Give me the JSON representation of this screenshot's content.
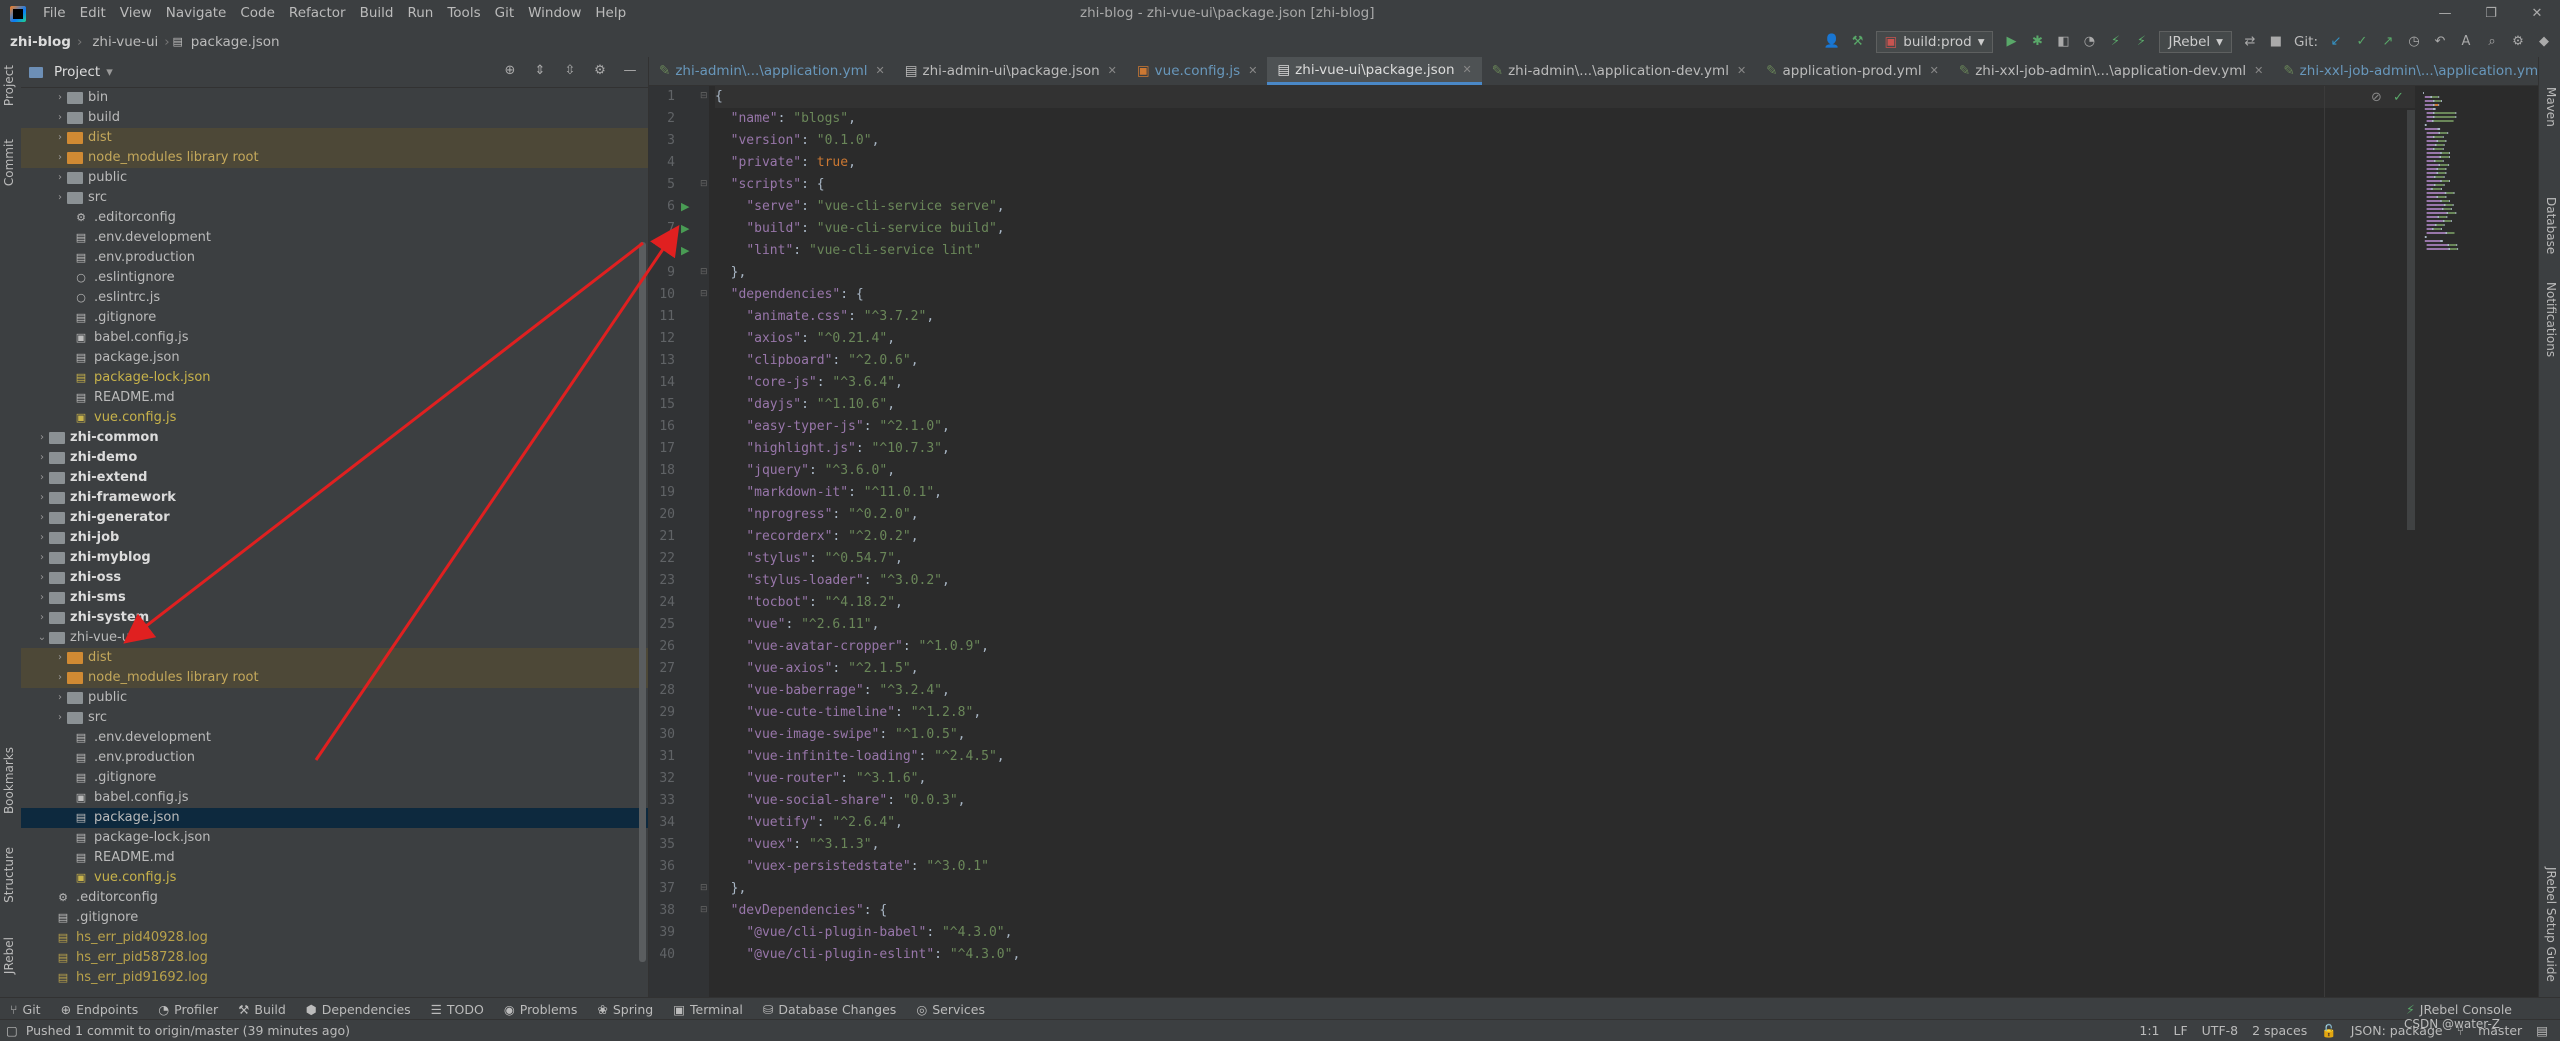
{
  "menubar": {
    "items": [
      "File",
      "Edit",
      "View",
      "Navigate",
      "Code",
      "Refactor",
      "Build",
      "Run",
      "Tools",
      "Git",
      "Window",
      "Help"
    ],
    "window_title": "zhi-blog - zhi-vue-ui\\package.json [zhi-blog]"
  },
  "navbar": {
    "breadcrumb": [
      "zhi-blog",
      "zhi-vue-ui",
      "package.json"
    ],
    "run_config": "build:prod",
    "jrebel": "JRebel",
    "git_label": "Git:"
  },
  "project_panel": {
    "title": "Project",
    "tree": [
      {
        "label": "bin",
        "type": "folder",
        "depth": 2,
        "arrow": "›",
        "style": "f-txt",
        "color": "grey"
      },
      {
        "label": "build",
        "type": "folder",
        "depth": 2,
        "arrow": "›",
        "style": "f-txt",
        "color": "grey"
      },
      {
        "label": "dist",
        "type": "folder",
        "depth": 2,
        "arrow": "›",
        "style": "f-excl",
        "color": "orange",
        "excluded": true
      },
      {
        "label": "node_modules  library root",
        "type": "folder",
        "depth": 2,
        "arrow": "›",
        "style": "f-excl",
        "color": "orange",
        "excluded": true
      },
      {
        "label": "public",
        "type": "folder",
        "depth": 2,
        "arrow": "›",
        "style": "f-txt",
        "color": "grey"
      },
      {
        "label": "src",
        "type": "folder",
        "depth": 2,
        "arrow": "›",
        "style": "f-txt",
        "color": "grey"
      },
      {
        "label": ".editorconfig",
        "type": "file",
        "depth": 2,
        "icon": "⚙",
        "style": "f-txt"
      },
      {
        "label": ".env.development",
        "type": "file",
        "depth": 2,
        "icon": "▤",
        "style": "f-txt"
      },
      {
        "label": ".env.production",
        "type": "file",
        "depth": 2,
        "icon": "▤",
        "style": "f-txt"
      },
      {
        "label": ".eslintignore",
        "type": "file",
        "depth": 2,
        "icon": "○",
        "style": "f-txt"
      },
      {
        "label": ".eslintrc.js",
        "type": "file",
        "depth": 2,
        "icon": "○",
        "style": "f-txt"
      },
      {
        "label": ".gitignore",
        "type": "file",
        "depth": 2,
        "icon": "▤",
        "style": "f-txt"
      },
      {
        "label": "babel.config.js",
        "type": "file",
        "depth": 2,
        "icon": "▣",
        "style": "f-txt"
      },
      {
        "label": "package.json",
        "type": "file",
        "depth": 2,
        "icon": "▤",
        "style": "f-txt"
      },
      {
        "label": "package-lock.json",
        "type": "file",
        "depth": 2,
        "icon": "▤",
        "style": "f-yellow"
      },
      {
        "label": "README.md",
        "type": "file",
        "depth": 2,
        "icon": "▤",
        "style": "f-txt"
      },
      {
        "label": "vue.config.js",
        "type": "file",
        "depth": 2,
        "icon": "▣",
        "style": "f-yellow"
      },
      {
        "label": "zhi-common",
        "type": "folder",
        "depth": 1,
        "arrow": "›",
        "style": "f-bold",
        "color": "mod"
      },
      {
        "label": "zhi-demo",
        "type": "folder",
        "depth": 1,
        "arrow": "›",
        "style": "f-bold",
        "color": "mod"
      },
      {
        "label": "zhi-extend",
        "type": "folder",
        "depth": 1,
        "arrow": "›",
        "style": "f-bold",
        "color": "mod"
      },
      {
        "label": "zhi-framework",
        "type": "folder",
        "depth": 1,
        "arrow": "›",
        "style": "f-bold",
        "color": "mod"
      },
      {
        "label": "zhi-generator",
        "type": "folder",
        "depth": 1,
        "arrow": "›",
        "style": "f-bold",
        "color": "mod"
      },
      {
        "label": "zhi-job",
        "type": "folder",
        "depth": 1,
        "arrow": "›",
        "style": "f-bold",
        "color": "mod"
      },
      {
        "label": "zhi-myblog",
        "type": "folder",
        "depth": 1,
        "arrow": "›",
        "style": "f-bold",
        "color": "mod"
      },
      {
        "label": "zhi-oss",
        "type": "folder",
        "depth": 1,
        "arrow": "›",
        "style": "f-bold",
        "color": "mod"
      },
      {
        "label": "zhi-sms",
        "type": "folder",
        "depth": 1,
        "arrow": "›",
        "style": "f-bold",
        "color": "mod"
      },
      {
        "label": "zhi-system",
        "type": "folder",
        "depth": 1,
        "arrow": "›",
        "style": "f-bold",
        "color": "mod"
      },
      {
        "label": "zhi-vue-ui",
        "type": "folder",
        "depth": 1,
        "arrow": "⌄",
        "style": "f-txt",
        "color": "grey"
      },
      {
        "label": "dist",
        "type": "folder",
        "depth": 2,
        "arrow": "›",
        "style": "f-excl",
        "color": "orange",
        "excluded": true
      },
      {
        "label": "node_modules  library root",
        "type": "folder",
        "depth": 2,
        "arrow": "›",
        "style": "f-excl",
        "color": "orange",
        "excluded": true
      },
      {
        "label": "public",
        "type": "folder",
        "depth": 2,
        "arrow": "›",
        "style": "f-txt",
        "color": "grey"
      },
      {
        "label": "src",
        "type": "folder",
        "depth": 2,
        "arrow": "›",
        "style": "f-txt",
        "color": "grey"
      },
      {
        "label": ".env.development",
        "type": "file",
        "depth": 2,
        "icon": "▤",
        "style": "f-txt"
      },
      {
        "label": ".env.production",
        "type": "file",
        "depth": 2,
        "icon": "▤",
        "style": "f-txt"
      },
      {
        "label": ".gitignore",
        "type": "file",
        "depth": 2,
        "icon": "▤",
        "style": "f-txt"
      },
      {
        "label": "babel.config.js",
        "type": "file",
        "depth": 2,
        "icon": "▣",
        "style": "f-txt"
      },
      {
        "label": "package.json",
        "type": "file",
        "depth": 2,
        "icon": "▤",
        "style": "f-txt",
        "selected": true
      },
      {
        "label": "package-lock.json",
        "type": "file",
        "depth": 2,
        "icon": "▤",
        "style": "f-txt"
      },
      {
        "label": "README.md",
        "type": "file",
        "depth": 2,
        "icon": "▤",
        "style": "f-txt"
      },
      {
        "label": "vue.config.js",
        "type": "file",
        "depth": 2,
        "icon": "▣",
        "style": "f-yellow"
      },
      {
        "label": ".editorconfig",
        "type": "file",
        "depth": 1,
        "icon": "⚙",
        "style": "f-txt"
      },
      {
        "label": ".gitignore",
        "type": "file",
        "depth": 1,
        "icon": "▤",
        "style": "f-txt"
      },
      {
        "label": "hs_err_pid40928.log",
        "type": "file",
        "depth": 1,
        "icon": "▤",
        "style": "f-log"
      },
      {
        "label": "hs_err_pid58728.log",
        "type": "file",
        "depth": 1,
        "icon": "▤",
        "style": "f-log"
      },
      {
        "label": "hs_err_pid91692.log",
        "type": "file",
        "depth": 1,
        "icon": "▤",
        "style": "f-log"
      }
    ]
  },
  "tabs": [
    {
      "label": "zhi-admin\\...\\application.yml",
      "icon": "yml",
      "modified": true
    },
    {
      "label": "zhi-admin-ui\\package.json",
      "icon": "json",
      "modified": false
    },
    {
      "label": "vue.config.js",
      "icon": "js",
      "modified": true
    },
    {
      "label": "zhi-vue-ui\\package.json",
      "icon": "json",
      "modified": false,
      "active": true
    },
    {
      "label": "zhi-admin\\...\\application-dev.yml",
      "icon": "yml",
      "modified": false
    },
    {
      "label": "application-prod.yml",
      "icon": "yml",
      "modified": false
    },
    {
      "label": "zhi-xxl-job-admin\\...\\application-dev.yml",
      "icon": "yml",
      "modified": false
    },
    {
      "label": "zhi-xxl-job-admin\\...\\application.yml",
      "icon": "yml",
      "modified": true
    }
  ],
  "code_lines": [
    [
      [
        "punc",
        "{"
      ]
    ],
    [
      [
        "pad",
        "  "
      ],
      [
        "key",
        "\"name\""
      ],
      [
        "punc",
        ": "
      ],
      [
        "str",
        "\"blogs\""
      ],
      [
        "punc",
        ","
      ]
    ],
    [
      [
        "pad",
        "  "
      ],
      [
        "key",
        "\"version\""
      ],
      [
        "punc",
        ": "
      ],
      [
        "str",
        "\"0.1.0\""
      ],
      [
        "punc",
        ","
      ]
    ],
    [
      [
        "pad",
        "  "
      ],
      [
        "key",
        "\"private\""
      ],
      [
        "punc",
        ": "
      ],
      [
        "kw",
        "true"
      ],
      [
        "punc",
        ","
      ]
    ],
    [
      [
        "pad",
        "  "
      ],
      [
        "key",
        "\"scripts\""
      ],
      [
        "punc",
        ": {"
      ]
    ],
    [
      [
        "pad",
        "    "
      ],
      [
        "key",
        "\"serve\""
      ],
      [
        "punc",
        ": "
      ],
      [
        "str",
        "\"vue-cli-service serve\""
      ],
      [
        "punc",
        ","
      ]
    ],
    [
      [
        "pad",
        "    "
      ],
      [
        "key",
        "\"build\""
      ],
      [
        "punc",
        ": "
      ],
      [
        "str",
        "\"vue-cli-service build\""
      ],
      [
        "punc",
        ","
      ]
    ],
    [
      [
        "pad",
        "    "
      ],
      [
        "key",
        "\"lint\""
      ],
      [
        "punc",
        ": "
      ],
      [
        "str",
        "\"vue-cli-service lint\""
      ]
    ],
    [
      [
        "pad",
        "  "
      ],
      [
        "punc",
        "},"
      ]
    ],
    [
      [
        "pad",
        "  "
      ],
      [
        "key",
        "\"dependencies\""
      ],
      [
        "punc",
        ": {"
      ]
    ],
    [
      [
        "pad",
        "    "
      ],
      [
        "key",
        "\"animate.css\""
      ],
      [
        "punc",
        ": "
      ],
      [
        "str",
        "\"^3.7.2\""
      ],
      [
        "punc",
        ","
      ]
    ],
    [
      [
        "pad",
        "    "
      ],
      [
        "key",
        "\"axios\""
      ],
      [
        "punc",
        ": "
      ],
      [
        "str",
        "\"^0.21.4\""
      ],
      [
        "punc",
        ","
      ]
    ],
    [
      [
        "pad",
        "    "
      ],
      [
        "key",
        "\"clipboard\""
      ],
      [
        "punc",
        ": "
      ],
      [
        "str",
        "\"^2.0.6\""
      ],
      [
        "punc",
        ","
      ]
    ],
    [
      [
        "pad",
        "    "
      ],
      [
        "key",
        "\"core-js\""
      ],
      [
        "punc",
        ": "
      ],
      [
        "str",
        "\"^3.6.4\""
      ],
      [
        "punc",
        ","
      ]
    ],
    [
      [
        "pad",
        "    "
      ],
      [
        "key",
        "\"dayjs\""
      ],
      [
        "punc",
        ": "
      ],
      [
        "str",
        "\"^1.10.6\""
      ],
      [
        "punc",
        ","
      ]
    ],
    [
      [
        "pad",
        "    "
      ],
      [
        "key",
        "\"easy-typer-js\""
      ],
      [
        "punc",
        ": "
      ],
      [
        "str",
        "\"^2.1.0\""
      ],
      [
        "punc",
        ","
      ]
    ],
    [
      [
        "pad",
        "    "
      ],
      [
        "key",
        "\"highlight.js\""
      ],
      [
        "punc",
        ": "
      ],
      [
        "str",
        "\"^10.7.3\""
      ],
      [
        "punc",
        ","
      ]
    ],
    [
      [
        "pad",
        "    "
      ],
      [
        "key",
        "\"jquery\""
      ],
      [
        "punc",
        ": "
      ],
      [
        "str",
        "\"^3.6.0\""
      ],
      [
        "punc",
        ","
      ]
    ],
    [
      [
        "pad",
        "    "
      ],
      [
        "key",
        "\"markdown-it\""
      ],
      [
        "punc",
        ": "
      ],
      [
        "str",
        "\"^11.0.1\""
      ],
      [
        "punc",
        ","
      ]
    ],
    [
      [
        "pad",
        "    "
      ],
      [
        "key",
        "\"nprogress\""
      ],
      [
        "punc",
        ": "
      ],
      [
        "str",
        "\"^0.2.0\""
      ],
      [
        "punc",
        ","
      ]
    ],
    [
      [
        "pad",
        "    "
      ],
      [
        "key",
        "\"recorderx\""
      ],
      [
        "punc",
        ": "
      ],
      [
        "str",
        "\"^2.0.2\""
      ],
      [
        "punc",
        ","
      ]
    ],
    [
      [
        "pad",
        "    "
      ],
      [
        "key",
        "\"stylus\""
      ],
      [
        "punc",
        ": "
      ],
      [
        "str",
        "\"^0.54.7\""
      ],
      [
        "punc",
        ","
      ]
    ],
    [
      [
        "pad",
        "    "
      ],
      [
        "key",
        "\"stylus-loader\""
      ],
      [
        "punc",
        ": "
      ],
      [
        "str",
        "\"^3.0.2\""
      ],
      [
        "punc",
        ","
      ]
    ],
    [
      [
        "pad",
        "    "
      ],
      [
        "key",
        "\"tocbot\""
      ],
      [
        "punc",
        ": "
      ],
      [
        "str",
        "\"^4.18.2\""
      ],
      [
        "punc",
        ","
      ]
    ],
    [
      [
        "pad",
        "    "
      ],
      [
        "key",
        "\"vue\""
      ],
      [
        "punc",
        ": "
      ],
      [
        "str",
        "\"^2.6.11\""
      ],
      [
        "punc",
        ","
      ]
    ],
    [
      [
        "pad",
        "    "
      ],
      [
        "key",
        "\"vue-avatar-cropper\""
      ],
      [
        "punc",
        ": "
      ],
      [
        "str",
        "\"^1.0.9\""
      ],
      [
        "punc",
        ","
      ]
    ],
    [
      [
        "pad",
        "    "
      ],
      [
        "key",
        "\"vue-axios\""
      ],
      [
        "punc",
        ": "
      ],
      [
        "str",
        "\"^2.1.5\""
      ],
      [
        "punc",
        ","
      ]
    ],
    [
      [
        "pad",
        "    "
      ],
      [
        "key",
        "\"vue-baberrage\""
      ],
      [
        "punc",
        ": "
      ],
      [
        "str",
        "\"^3.2.4\""
      ],
      [
        "punc",
        ","
      ]
    ],
    [
      [
        "pad",
        "    "
      ],
      [
        "key",
        "\"vue-cute-timeline\""
      ],
      [
        "punc",
        ": "
      ],
      [
        "str",
        "\"^1.2.8\""
      ],
      [
        "punc",
        ","
      ]
    ],
    [
      [
        "pad",
        "    "
      ],
      [
        "key",
        "\"vue-image-swipe\""
      ],
      [
        "punc",
        ": "
      ],
      [
        "str",
        "\"^1.0.5\""
      ],
      [
        "punc",
        ","
      ]
    ],
    [
      [
        "pad",
        "    "
      ],
      [
        "key",
        "\"vue-infinite-loading\""
      ],
      [
        "punc",
        ": "
      ],
      [
        "str",
        "\"^2.4.5\""
      ],
      [
        "punc",
        ","
      ]
    ],
    [
      [
        "pad",
        "    "
      ],
      [
        "key",
        "\"vue-router\""
      ],
      [
        "punc",
        ": "
      ],
      [
        "str",
        "\"^3.1.6\""
      ],
      [
        "punc",
        ","
      ]
    ],
    [
      [
        "pad",
        "    "
      ],
      [
        "key",
        "\"vue-social-share\""
      ],
      [
        "punc",
        ": "
      ],
      [
        "str",
        "\"0.0.3\""
      ],
      [
        "punc",
        ","
      ]
    ],
    [
      [
        "pad",
        "    "
      ],
      [
        "key",
        "\"vuetify\""
      ],
      [
        "punc",
        ": "
      ],
      [
        "str",
        "\"^2.6.4\""
      ],
      [
        "punc",
        ","
      ]
    ],
    [
      [
        "pad",
        "    "
      ],
      [
        "key",
        "\"vuex\""
      ],
      [
        "punc",
        ": "
      ],
      [
        "str",
        "\"^3.1.3\""
      ],
      [
        "punc",
        ","
      ]
    ],
    [
      [
        "pad",
        "    "
      ],
      [
        "key",
        "\"vuex-persistedstate\""
      ],
      [
        "punc",
        ": "
      ],
      [
        "str",
        "\"^3.0.1\""
      ]
    ],
    [
      [
        "pad",
        "  "
      ],
      [
        "punc",
        "},"
      ]
    ],
    [
      [
        "pad",
        "  "
      ],
      [
        "key",
        "\"devDependencies\""
      ],
      [
        "punc",
        ": {"
      ]
    ],
    [
      [
        "pad",
        "    "
      ],
      [
        "key",
        "\"@vue/cli-plugin-babel\""
      ],
      [
        "punc",
        ": "
      ],
      [
        "str",
        "\"^4.3.0\""
      ],
      [
        "punc",
        ","
      ]
    ],
    [
      [
        "pad",
        "    "
      ],
      [
        "key",
        "\"@vue/cli-plugin-eslint\""
      ],
      [
        "punc",
        ": "
      ],
      [
        "str",
        "\"^4.3.0\""
      ],
      [
        "punc",
        ","
      ]
    ]
  ],
  "bottom_tools": [
    "Git",
    "Endpoints",
    "Profiler",
    "Build",
    "Dependencies",
    "TODO",
    "Problems",
    "Spring",
    "Terminal",
    "Database Changes",
    "Services"
  ],
  "bottom_tool_icons": [
    "git-icon",
    "endpoints-icon",
    "profiler-icon",
    "build-icon",
    "dependencies-icon",
    "todo-icon",
    "problems-icon",
    "spring-icon",
    "terminal-icon",
    "database-changes-icon",
    "services-icon"
  ],
  "jrebel_console": "JRebel Console",
  "status": {
    "message": "Pushed 1 commit to origin/master (39 minutes ago)",
    "position": "1:1",
    "line_sep": "LF",
    "encoding": "UTF-8",
    "indent": "2 spaces",
    "schema": "JSON: package",
    "branch": "master",
    "watermark": "CSDN @water-Z"
  },
  "left_tabs": [
    "Project",
    "Commit",
    "Bookmarks",
    "Structure",
    "JRebel"
  ],
  "right_tabs": [
    "Maven",
    "Database",
    "Notifications",
    "JRebel Setup Guide"
  ]
}
